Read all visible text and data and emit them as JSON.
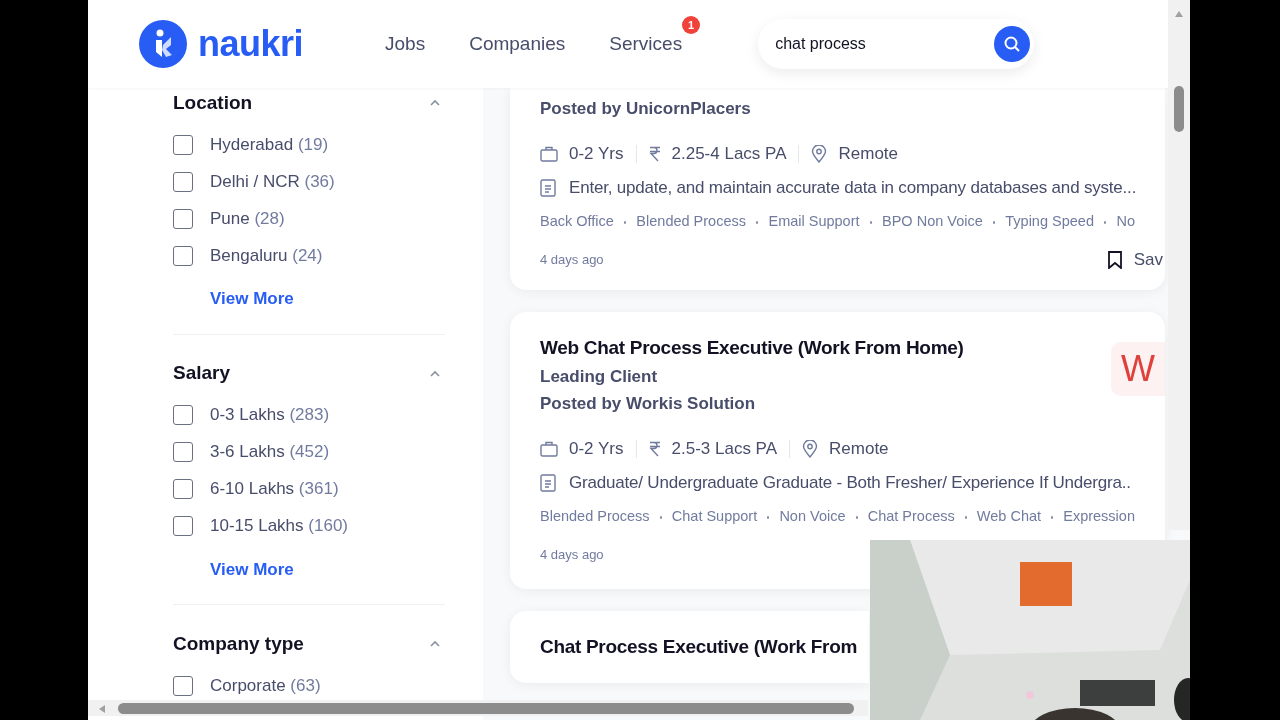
{
  "header": {
    "logo": "naukri",
    "nav": [
      {
        "label": "Jobs"
      },
      {
        "label": "Companies"
      },
      {
        "label": "Services",
        "badge": "1"
      }
    ],
    "search": {
      "value": "chat process"
    }
  },
  "filters": [
    {
      "title": "Location",
      "expanded": true,
      "options": [
        {
          "label": "Hyderabad",
          "count": "(19)",
          "checked": false
        },
        {
          "label": "Delhi / NCR",
          "count": "(36)",
          "checked": false
        },
        {
          "label": "Pune",
          "count": "(28)",
          "checked": false
        },
        {
          "label": "Bengaluru",
          "count": "(24)",
          "checked": false
        }
      ],
      "more": "View More"
    },
    {
      "title": "Salary",
      "expanded": true,
      "options": [
        {
          "label": "0-3 Lakhs",
          "count": "(283)",
          "checked": false
        },
        {
          "label": "3-6 Lakhs",
          "count": "(452)",
          "checked": false
        },
        {
          "label": "6-10 Lakhs",
          "count": "(361)",
          "checked": false
        },
        {
          "label": "10-15 Lakhs",
          "count": "(160)",
          "checked": false
        }
      ],
      "more": "View More"
    },
    {
      "title": "Company type",
      "expanded": true,
      "options": [
        {
          "label": "Corporate",
          "count": "(63)",
          "checked": false
        }
      ]
    }
  ],
  "jobs": [
    {
      "posted_by": "Posted by UnicornPlacers",
      "experience": "0-2 Yrs",
      "salary": "2.25-4 Lacs PA",
      "location": "Remote",
      "description": "Enter, update, and maintain accurate data in company databases and syste...",
      "tags": [
        "Back Office",
        "Blended Process",
        "Email Support",
        "BPO Non Voice",
        "Typing Speed",
        "No"
      ],
      "posted": "4 days ago",
      "save": "Sav"
    },
    {
      "title": "Web Chat Process Executive (Work From Home)",
      "company": "Leading Client",
      "posted_by": "Posted by Workis Solution",
      "logo_letter": "W",
      "experience": "0-2 Yrs",
      "salary": "2.5-3 Lacs PA",
      "location": "Remote",
      "description": "Graduate/ Undergraduate Graduate - Both Fresher/ Experience If Undergra..",
      "tags": [
        "Blended Process",
        "Chat Support",
        "Non Voice",
        "Chat Process",
        "Web Chat",
        "Expression"
      ],
      "posted": "4 days ago"
    },
    {
      "title": "Chat Process Executive (Work From"
    }
  ]
}
